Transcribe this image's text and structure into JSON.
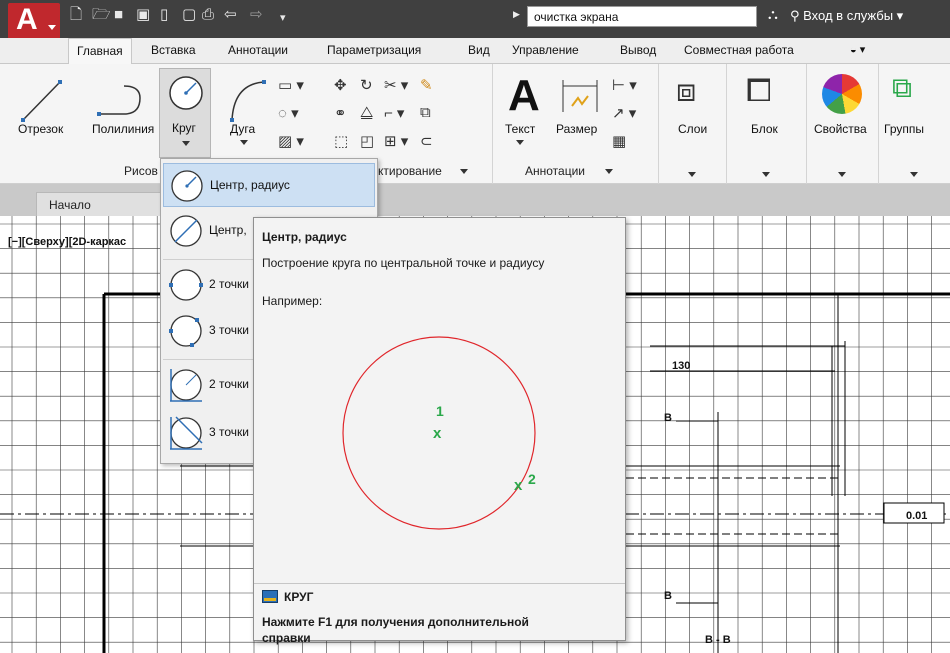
{
  "search": {
    "value": "очистка экрана"
  },
  "header": {
    "login_label": "Вход в службы"
  },
  "tabs": [
    {
      "label": "Главная"
    },
    {
      "label": "Вставка"
    },
    {
      "label": "Аннотации"
    },
    {
      "label": "Параметризация"
    },
    {
      "label": "Вид"
    },
    {
      "label": "Управление"
    },
    {
      "label": "Вывод"
    },
    {
      "label": "Совместная работа"
    }
  ],
  "ribbon": {
    "line": "Отрезок",
    "polyline": "Полилиния",
    "circle": "Круг",
    "arc": "Дуга",
    "draw_group": "Рисов",
    "modify_group": "ктирование",
    "text": "Текст",
    "dimension": "Размер",
    "annotations_group": "Аннотации",
    "layers": "Слои",
    "block": "Блок",
    "properties": "Свойства",
    "groups": "Группы"
  },
  "filetab": {
    "start": "Начало"
  },
  "viewport": {
    "label": "[−][Сверху][2D-каркас"
  },
  "menu": {
    "items": [
      {
        "label": "Центр, радиус"
      },
      {
        "label": "Центр,"
      },
      {
        "label": "2 точки"
      },
      {
        "label": "3 точки"
      },
      {
        "label": "2 точки"
      },
      {
        "label": "3 точки"
      }
    ]
  },
  "tooltip": {
    "title": "Центр, радиус",
    "description": "Построение круга по центральной точке и радиусу",
    "example": "Например:",
    "marker1": "1",
    "marker2": "2",
    "mark": "x",
    "command": "КРУГ",
    "help": "Нажмите F1 для получения дополнительной справки"
  },
  "drawing": {
    "dim_130": "130",
    "section_b1": "B",
    "section_b2": "B",
    "section_bb": "B - B",
    "tolerance": "0.01"
  },
  "colors": {
    "accent_red": "#c0282d",
    "circle_red": "#e0262b",
    "marker_green": "#2aa84a"
  }
}
